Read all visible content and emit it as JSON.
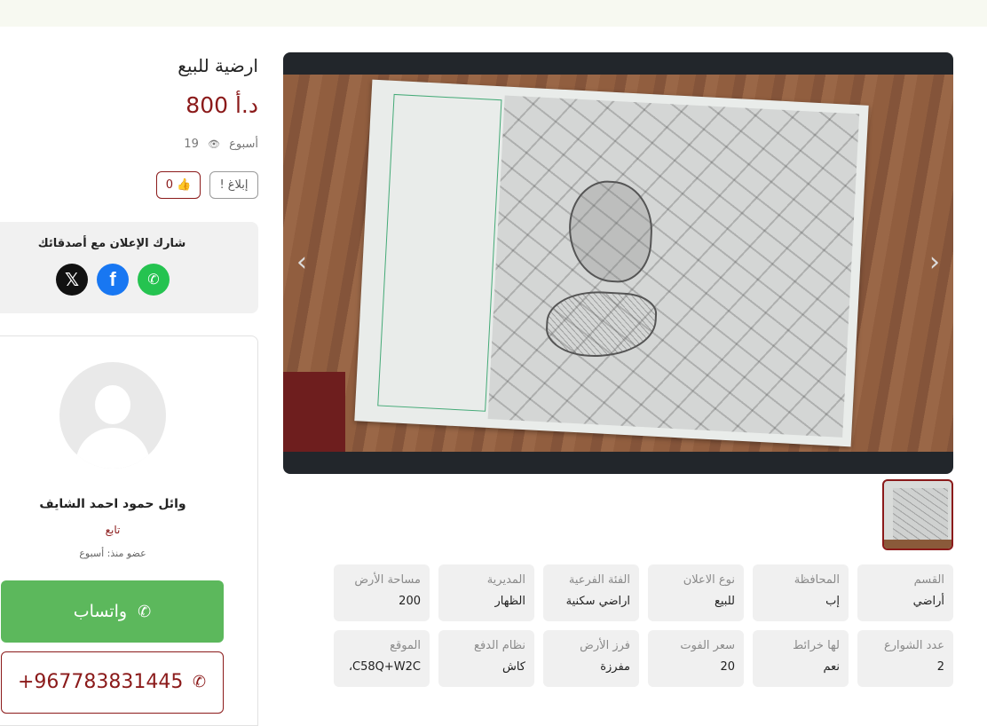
{
  "listing": {
    "title": "ارضية للبيع",
    "price": "800 د.أ",
    "posted": "أسبوع",
    "views": "19",
    "report_label": "إبلاغ",
    "likes": "0"
  },
  "share": {
    "label": "شارك الإعلان مع أصدقائك",
    "icons": [
      "x-icon",
      "facebook-icon",
      "whatsapp-icon"
    ]
  },
  "seller": {
    "name": "وائل حمود احمد الشايف",
    "follow_label": "تابع",
    "member_since": "عضو منذ: أسبوع",
    "whatsapp_label": "واتساب",
    "phone": "+967783831445"
  },
  "attributes": [
    {
      "key": "القسم",
      "value": "أراضي"
    },
    {
      "key": "المحافظة",
      "value": "إب"
    },
    {
      "key": "نوع الاعلان",
      "value": "للبيع"
    },
    {
      "key": "الفئة الفرعية",
      "value": "اراضي سكنية"
    },
    {
      "key": "المديرية",
      "value": "الظهار"
    },
    {
      "key": "مساحة الأرض",
      "value": "200"
    },
    {
      "key": "عدد الشوارع",
      "value": "2"
    },
    {
      "key": "لها خرائط",
      "value": "نعم"
    },
    {
      "key": "سعر الفوت",
      "value": "20"
    },
    {
      "key": "فرز الأرض",
      "value": "مفرزة"
    },
    {
      "key": "نظام الدفع",
      "value": "كاش"
    },
    {
      "key": "الموقع",
      "value": "C58Q+W2C،"
    }
  ],
  "colors": {
    "accent": "#8b1a1a",
    "whatsapp": "#5cb85c",
    "card_bg": "#f0f0f0"
  }
}
